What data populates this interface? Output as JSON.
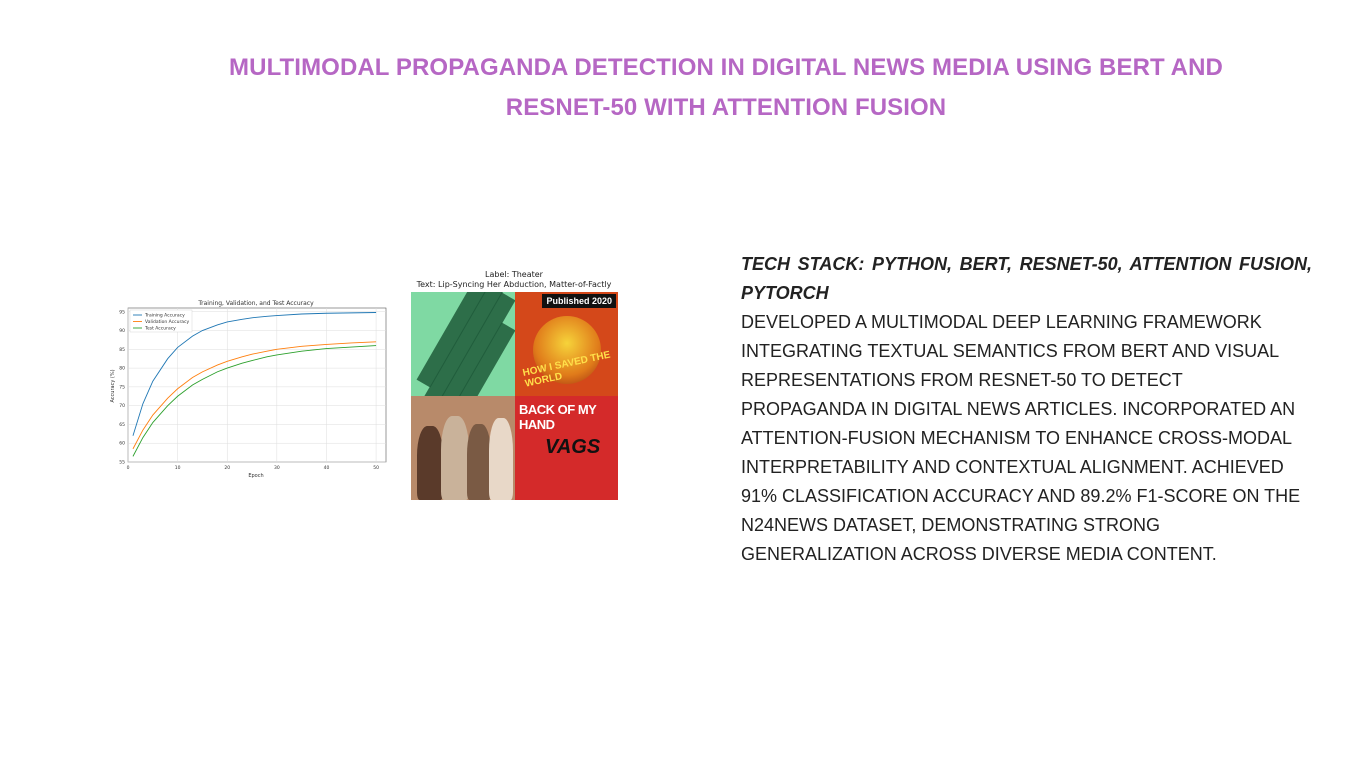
{
  "page": {
    "title": "MULTIMODAL PROPAGANDA DETECTION IN DIGITAL NEWS MEDIA USING BERT AND RESNET-50 WITH ATTENTION FUSION",
    "title_color": "#b667c4"
  },
  "project": {
    "tech_stack": "TECH STACK: PYTHON, BERT, RESNET-50, ATTENTION FUSION, PYTORCH",
    "description": "DEVELOPED A MULTIMODAL DEEP LEARNING FRAMEWORK INTEGRATING TEXTUAL SEMANTICS FROM BERT AND VISUAL REPRESENTATIONS FROM RESNET-50 TO DETECT PROPAGANDA IN DIGITAL NEWS ARTICLES. INCORPORATED AN ATTENTION-FUSION MECHANISM TO ENHANCE CROSS-MODAL INTERPRETABILITY AND CONTEXTUAL ALIGNMENT. ACHIEVED 91% CLASSIFICATION ACCURACY AND 89.2% F1-SCORE ON THE N24NEWS DATASET, DEMONSTRATING STRONG GENERALIZATION ACROSS DIVERSE MEDIA CONTENT."
  },
  "collage": {
    "label": "Label: Theater",
    "text": "Text: Lip-Syncing Her Abduction, Matter-of-Factly",
    "badge": "Published 2020",
    "tile_text_1": "HOW I SAVED THE WORLD",
    "tile_text_2": "BACK OF MY HAND",
    "tile_text_3": "VAGS"
  },
  "chart_data": {
    "type": "line",
    "title": "Training, Validation, and Test Accuracy",
    "xlabel": "Epoch",
    "ylabel": "Accuracy (%)",
    "xlim": [
      0,
      52
    ],
    "ylim": [
      55,
      96
    ],
    "xticks": [
      0,
      10,
      20,
      30,
      40,
      50
    ],
    "yticks": [
      55,
      60,
      65,
      70,
      75,
      80,
      85,
      90,
      95
    ],
    "grid": true,
    "legend_position": "top-left",
    "x": [
      1,
      3,
      5,
      8,
      10,
      13,
      15,
      18,
      20,
      23,
      25,
      28,
      30,
      35,
      40,
      45,
      50
    ],
    "series": [
      {
        "name": "Training Accuracy",
        "color": "#1f77b4",
        "values": [
          62,
          70.5,
          76.5,
          82.5,
          85.5,
          88.5,
          90,
          91.5,
          92.3,
          93,
          93.4,
          93.8,
          94,
          94.4,
          94.6,
          94.7,
          94.8
        ]
      },
      {
        "name": "Validation Accuracy",
        "color": "#ff7f0e",
        "values": [
          58.5,
          63.5,
          67.5,
          72,
          74.5,
          77.5,
          79,
          80.8,
          81.8,
          83,
          83.7,
          84.5,
          85,
          85.8,
          86.3,
          86.7,
          87
        ]
      },
      {
        "name": "Test Accuracy",
        "color": "#2ca02c",
        "values": [
          56.5,
          61.5,
          65.5,
          70,
          72.5,
          75.5,
          77,
          79,
          80,
          81.3,
          82,
          83,
          83.5,
          84.5,
          85.2,
          85.6,
          86
        ]
      }
    ]
  }
}
